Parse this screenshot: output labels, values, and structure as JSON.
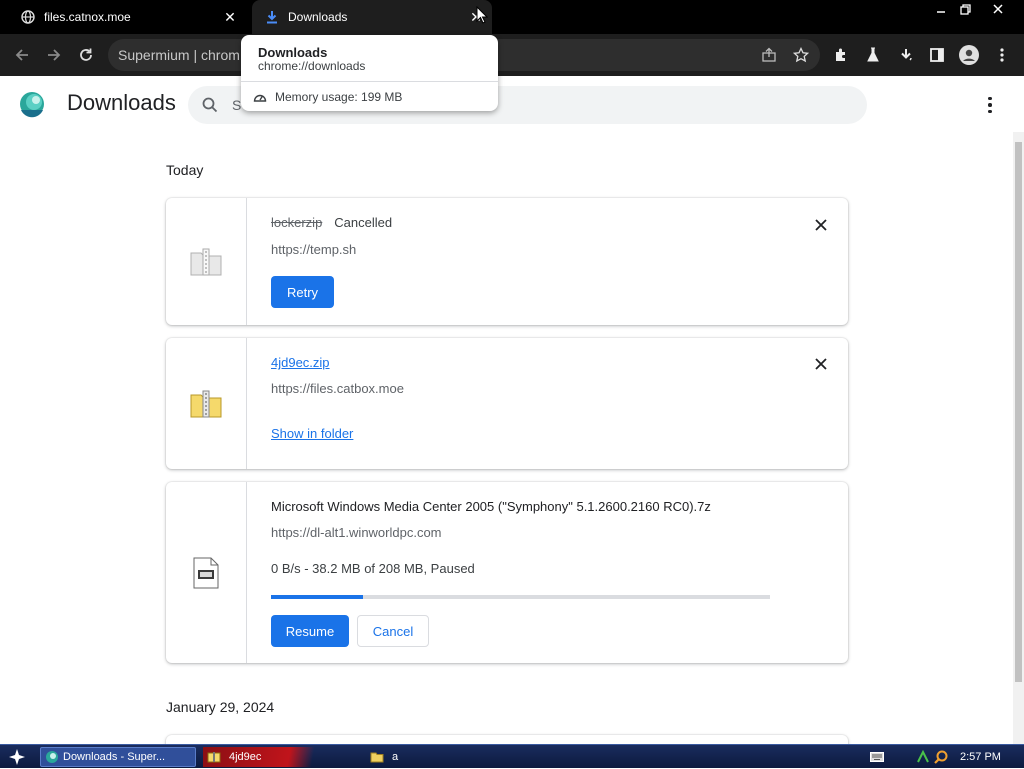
{
  "tabs": [
    {
      "title": "files.catnox.moe",
      "favicon": "globe-icon"
    },
    {
      "title": "Downloads",
      "favicon": "download-icon",
      "active": true
    }
  ],
  "omnibox": {
    "text": "Supermium  |  chrom"
  },
  "tooltip": {
    "title": "Downloads",
    "url": "chrome://downloads",
    "memory": "Memory usage: 199 MB"
  },
  "header": {
    "title": "Downloads",
    "search_placeholder": "S"
  },
  "sections": [
    {
      "label": "Today"
    },
    {
      "label": "January 29, 2024"
    }
  ],
  "downloads": [
    {
      "filename": "lockerzip",
      "status": "Cancelled",
      "url": "https://temp.sh",
      "action": "Retry",
      "icon": "zip-file-icon"
    },
    {
      "filename": "4jd9ec.zip",
      "url": "https://files.catbox.moe",
      "action": "Show in folder",
      "icon": "zip-folder-icon"
    },
    {
      "filename": "Microsoft Windows Media Center 2005 (\"Symphony\" 5.1.2600.2160 RC0).7z",
      "url": "https://dl-alt1.winworldpc.com",
      "progress_text": "0 B/s - 38.2 MB of 208 MB, Paused",
      "progress": 0.1837,
      "primary_action": "Resume",
      "secondary_action": "Cancel",
      "icon": "7z-file-icon"
    }
  ],
  "taskbar": {
    "items": [
      {
        "label": "Downloads - Super...",
        "active": true
      },
      {
        "label": "4jd9ec"
      },
      {
        "label": "a"
      }
    ],
    "clock": "2:57 PM"
  },
  "colors": {
    "accent": "#1a73e8",
    "toolbar": "#1e1e1e",
    "tabbar": "#000000"
  }
}
